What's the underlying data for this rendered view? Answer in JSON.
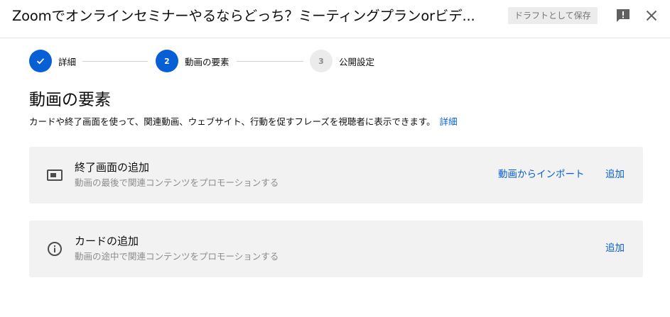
{
  "header": {
    "title": "Zoomでオンラインセミナーやるならどっち？ミーティングプランorビデ...",
    "draft_label": "ドラフトとして保存",
    "feedback_icon": "feedback-icon",
    "close_icon": "close-icon"
  },
  "stepper": {
    "steps": [
      {
        "label": "詳細",
        "marker": "✓",
        "state": "done"
      },
      {
        "label": "動画の要素",
        "marker": "2",
        "state": "active"
      },
      {
        "label": "公開設定",
        "marker": "3",
        "state": "pending"
      }
    ]
  },
  "section": {
    "title": "動画の要素",
    "description": "カードや終了画面を使って、関連動画、ウェブサイト、行動を促すフレーズを視聴者に表示できます。",
    "details_link": "詳細"
  },
  "cards": [
    {
      "icon": "end-screen-icon",
      "title": "終了画面の追加",
      "subtitle": "動画の最後で関連コンテンツをプロモーションする",
      "import_label": "動画からインポート",
      "add_label": "追加"
    },
    {
      "icon": "info-icon",
      "title": "カードの追加",
      "subtitle": "動画の途中で関連コンテンツをプロモーションする",
      "add_label": "追加"
    }
  ],
  "colors": {
    "accent": "#065fd4",
    "card_background": "#f2f2f2",
    "secondary_text": "#8c8c8c"
  }
}
